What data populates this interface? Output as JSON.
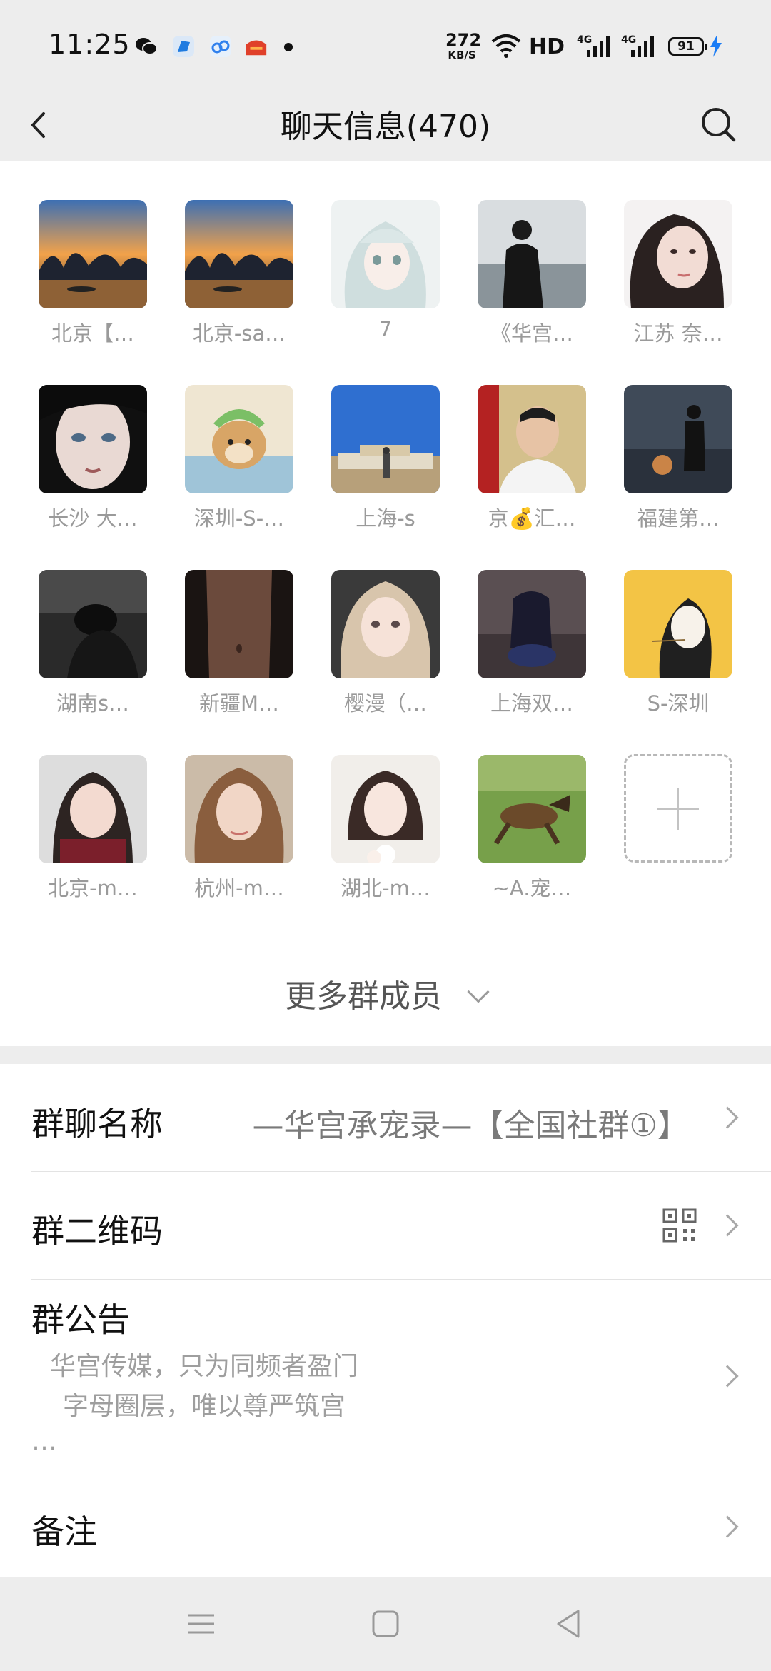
{
  "status_bar": {
    "time": "11:25",
    "net_speed_value": "272",
    "net_speed_unit": "KB/S",
    "hd_label": "HD",
    "battery": "91",
    "icons": [
      "wechat-icon",
      "blue-app-icon",
      "cloud-app-icon",
      "red-app-icon",
      "wifi-icon",
      "signal-4g-icon",
      "signal-4g-icon",
      "battery-icon",
      "charging-icon"
    ]
  },
  "nav": {
    "title": "聊天信息(470)"
  },
  "members": [
    {
      "name": "北京【…",
      "avatar": "landscape-sunset"
    },
    {
      "name": "北京-sa…",
      "avatar": "landscape-sunset"
    },
    {
      "name": "7",
      "avatar": "anime-girl"
    },
    {
      "name": "《华宫…",
      "avatar": "man-sea"
    },
    {
      "name": "江苏 奈…",
      "avatar": "woman-portrait"
    },
    {
      "name": "长沙 大…",
      "avatar": "woman-closeup"
    },
    {
      "name": "深圳-S-…",
      "avatar": "dog-costume"
    },
    {
      "name": "上海-s",
      "avatar": "temple-sky"
    },
    {
      "name": "京💰汇…",
      "avatar": "man-suit"
    },
    {
      "name": "福建第…",
      "avatar": "man-water-night"
    },
    {
      "name": "湖南s…",
      "avatar": "dark-room"
    },
    {
      "name": "新疆M…",
      "avatar": "body-dark"
    },
    {
      "name": "樱漫（…",
      "avatar": "blonde-woman"
    },
    {
      "name": "上海双…",
      "avatar": "sofa-girl"
    },
    {
      "name": "S-深圳",
      "avatar": "illustrated-man-yellow"
    },
    {
      "name": "北京-m…",
      "avatar": "woman-pose"
    },
    {
      "name": "杭州-m…",
      "avatar": "woman-brown-hair"
    },
    {
      "name": "湖北-m…",
      "avatar": "woman-flower"
    },
    {
      "name": "~A.宠…",
      "avatar": "dog-running"
    }
  ],
  "more_members_label": "更多群成员",
  "settings": {
    "group_name_label": "群聊名称",
    "group_name_value": "—华宫承宠录—【全国社群①】",
    "qr_label": "群二维码",
    "notice_label": "群公告",
    "notice_line1": "华宫传媒，只为同频者盈门",
    "notice_line2": "字母圈层，唯以尊严筑宫",
    "notice_line3": "…",
    "remark_label": "备注"
  },
  "system_nav": [
    "menu-icon",
    "home-icon",
    "back-triangle-icon"
  ]
}
